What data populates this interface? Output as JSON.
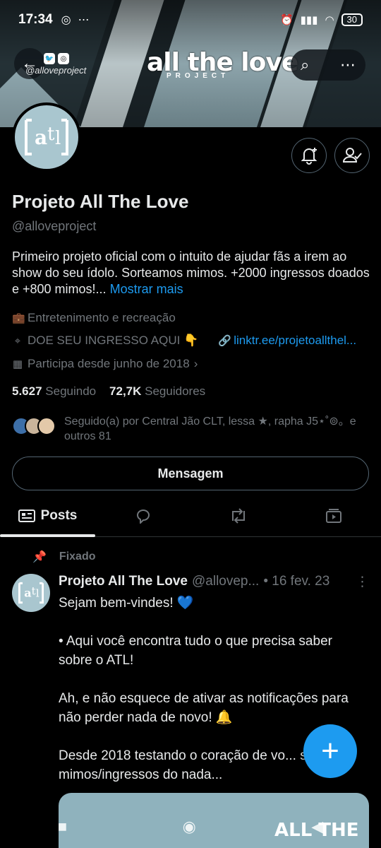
{
  "status_bar": {
    "time": "17:34",
    "battery": "30",
    "instagram_icon": "instagram-icon",
    "more": "⋯"
  },
  "banner": {
    "title": "all the love",
    "subtitle": "PROJECT",
    "handle": "@alloveproject"
  },
  "profile": {
    "name": "Projeto All The Love",
    "handle": "@alloveproject",
    "bio_text": "Primeiro projeto oficial com o intuito de ajudar fãs a irem ao show do seu ídolo. Sorteamos mimos. +2000 ingressos doados e +800 mimos!...",
    "bio_more": "Mostrar mais",
    "category": "Entretenimento e recreação",
    "location": "DOE SEU INGRESSO AQUI 👇",
    "website": "linktr.ee/projetoallthel...",
    "joined": "Participa desde junho de 2018",
    "following_count": "5.627",
    "following_label": "Seguindo",
    "followers_count": "72,7K",
    "followers_label": "Seguidores",
    "followed_by": "Seguido(a) por Central Jão CLT, lessa ★, rapha J5⋆˚⊚。e outros 81",
    "message_button": "Mensagem"
  },
  "tabs": [
    {
      "label": "Posts",
      "icon": "posts-icon"
    },
    {
      "label": "",
      "icon": "reply-icon"
    },
    {
      "label": "",
      "icon": "repost-icon"
    },
    {
      "label": "",
      "icon": "media-icon"
    }
  ],
  "tweet": {
    "pinned_label": "Fixado",
    "author": "Projeto All The Love",
    "handle": "@allovep...",
    "date": "• 16 fev. 23",
    "line1": "Sejam bem-vindes! 💙",
    "line2": "•  Aqui você encontra tudo o que precisa saber sobre o ATL!",
    "line3": "Ah, e não esquece de ativar as notificações para não perder nada de novo!  🔔",
    "line4": "Desde 2018 testando o coração de vo... soltando mimos/ingressos do nada...",
    "media_text": "ALL THE"
  },
  "colors": {
    "accent": "#1d9bf0",
    "background": "#000000",
    "avatar_bg": "#a9c6cf"
  }
}
